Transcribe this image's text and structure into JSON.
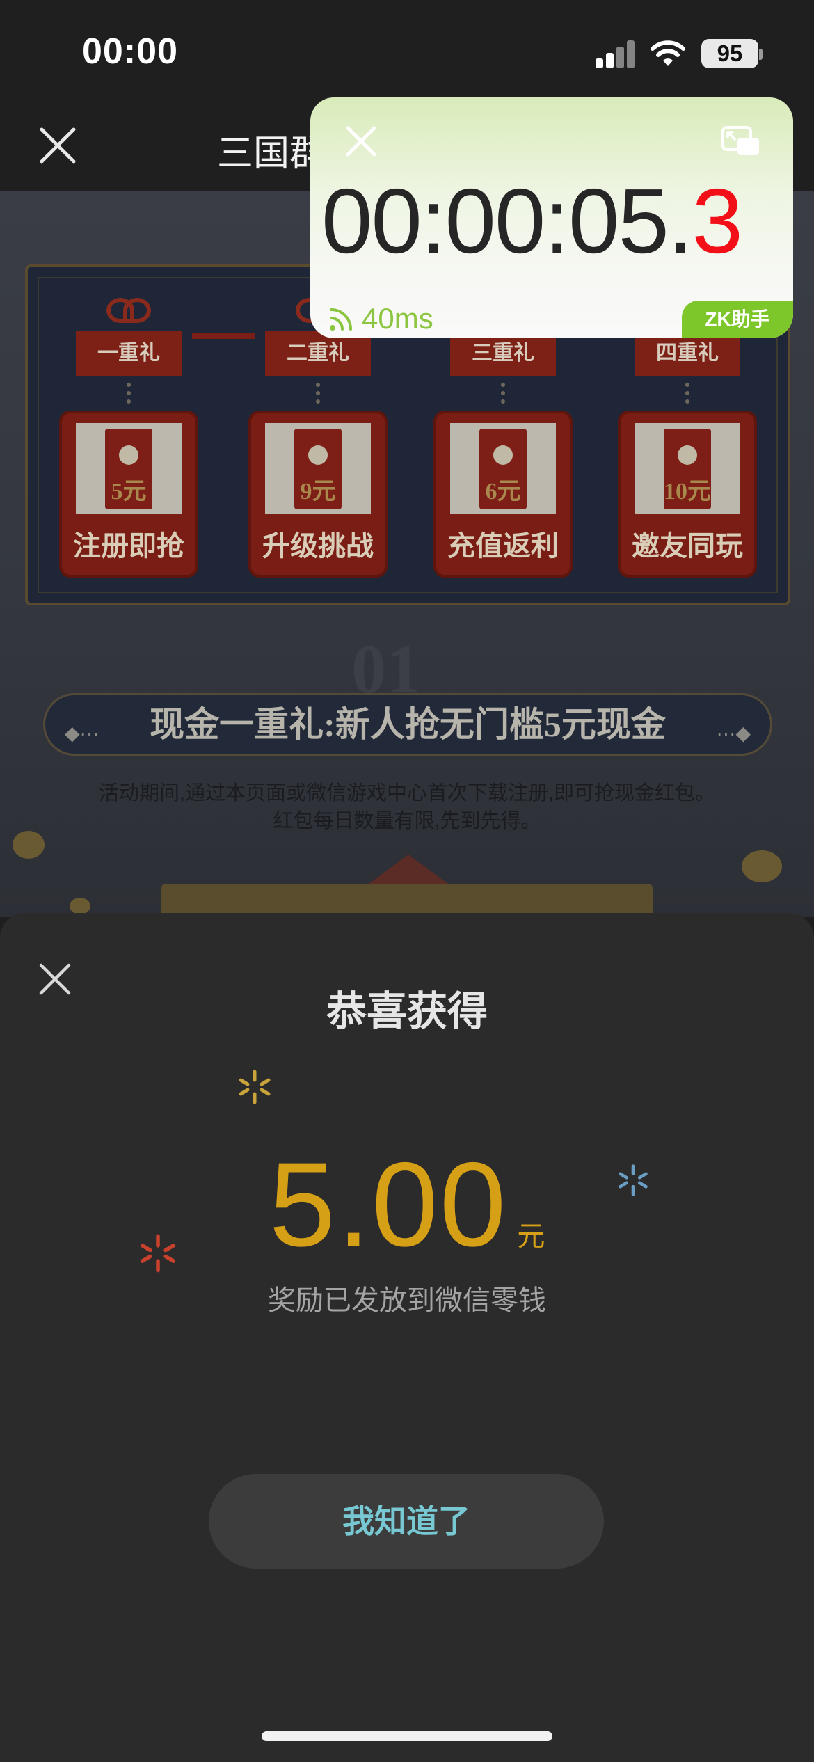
{
  "status_bar": {
    "time": "00:00",
    "battery": "95"
  },
  "navbar": {
    "title": "三国群"
  },
  "page": {
    "tiers": [
      {
        "tag": "一重礼",
        "amount": "5元",
        "label": "注册即抢"
      },
      {
        "tag": "二重礼",
        "amount": "9元",
        "label": "升级挑战"
      },
      {
        "tag": "三重礼",
        "amount": "6元",
        "label": "充值返利"
      },
      {
        "tag": "四重礼",
        "amount": "10元",
        "label": "邀友同玩"
      }
    ],
    "section_number": "01",
    "banner": "现金一重礼:新人抢无门槛5元现金",
    "description_line1": "活动期间,通过本页面或微信游戏中心首次下载注册,即可抢现金红包。",
    "description_line2": "红包每日数量有限,先到先得。"
  },
  "timer": {
    "time_main": "00:00:05.",
    "time_tenth": "3",
    "latency": "40ms",
    "badge": "ZK助手"
  },
  "sheet": {
    "title": "恭喜获得",
    "amount": "5.00",
    "unit": "元",
    "note": "奖励已发放到微信零钱",
    "button": "我知道了"
  },
  "colors": {
    "accent_gold": "#d59f16",
    "button_text": "#77c8d2",
    "timer_red": "#f20f17",
    "badge_green": "#7ec72b",
    "sheet_bg": "#2b2b2b"
  }
}
